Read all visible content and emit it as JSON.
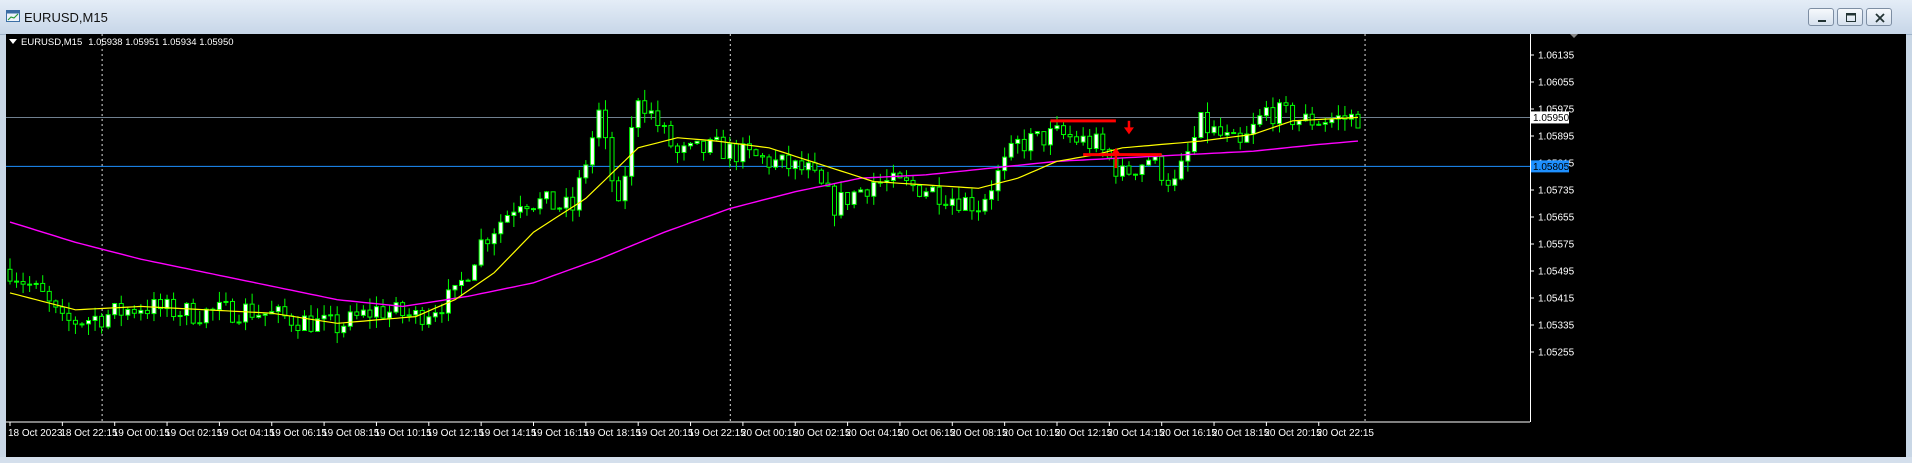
{
  "window": {
    "title": "EURUSD,M15",
    "minimize_icon": "minimize-icon",
    "maximize_icon": "maximize-icon",
    "close_icon": "close-icon"
  },
  "chart_info": {
    "symbol": "EURUSD,M15",
    "quotes": "1.05938 1.05951 1.05934 1.05950"
  },
  "colors": {
    "background": "#000000",
    "foreground": "#ffffff",
    "bull_candle": "#00ff00",
    "bear_candle_body": "#000000",
    "fast_ma": "#ffff00",
    "slow_ma": "#ff00ff",
    "bid_line": "#708090",
    "horizontal_line": "#1e90ff",
    "bid_tag": "#ffffff",
    "hline_tag": "#1e90ff",
    "annotation": "#ff0000"
  },
  "chart_data": {
    "type": "candlestick",
    "yaxis": {
      "ylim": [
        1.0524,
        1.0619
      ],
      "tick_values": [
        1.06135,
        1.06055,
        1.05975,
        1.05895,
        1.05815,
        1.05735,
        1.05655,
        1.05575,
        1.05495,
        1.05415,
        1.05335,
        1.05255
      ],
      "tick_labels": [
        "1.06135",
        "1.06055",
        "1.05975",
        "1.05895",
        "1.05815",
        "1.05735",
        "1.05655",
        "1.05575",
        "1.05495",
        "1.05415",
        "1.05335",
        "1.05255"
      ]
    },
    "xaxis": {
      "tick_labels": [
        "18 Oct 2023",
        "18 Oct 22:15",
        "19 Oct 00:15",
        "19 Oct 02:15",
        "19 Oct 04:15",
        "19 Oct 06:15",
        "19 Oct 08:15",
        "19 Oct 10:15",
        "19 Oct 12:15",
        "19 Oct 14:15",
        "19 Oct 16:15",
        "19 Oct 18:15",
        "19 Oct 20:15",
        "19 Oct 22:15",
        "20 Oct 00:15",
        "20 Oct 02:15",
        "20 Oct 04:15",
        "20 Oct 06:15",
        "20 Oct 08:15",
        "20 Oct 10:15",
        "20 Oct 12:15",
        "20 Oct 14:15",
        "20 Oct 16:15",
        "20 Oct 18:15",
        "20 Oct 20:15",
        "20 Oct 22:15"
      ],
      "tick_bar_index": [
        0,
        8,
        16,
        24,
        32,
        40,
        48,
        56,
        64,
        72,
        80,
        88,
        96,
        104,
        112,
        120,
        128,
        136,
        144,
        152,
        160,
        168,
        176,
        184,
        192,
        200
      ],
      "day_separator_bar_index": [
        14,
        110,
        207
      ]
    },
    "close_path_anchors": [
      [
        0,
        1.055
      ],
      [
        5,
        1.0542
      ],
      [
        8,
        1.0534
      ],
      [
        14,
        1.0536
      ],
      [
        20,
        1.0539
      ],
      [
        28,
        1.0537
      ],
      [
        36,
        1.0538
      ],
      [
        44,
        1.0535
      ],
      [
        50,
        1.0533
      ],
      [
        56,
        1.0538
      ],
      [
        62,
        1.0536
      ],
      [
        68,
        1.0542
      ],
      [
        72,
        1.0558
      ],
      [
        78,
        1.0571
      ],
      [
        86,
        1.0568
      ],
      [
        90,
        1.0596
      ],
      [
        93,
        1.0567
      ],
      [
        96,
        1.0602
      ],
      [
        99,
        1.0593
      ],
      [
        102,
        1.0584
      ],
      [
        108,
        1.0586
      ],
      [
        114,
        1.0583
      ],
      [
        122,
        1.0579
      ],
      [
        126,
        1.0569
      ],
      [
        132,
        1.0576
      ],
      [
        140,
        1.0574
      ],
      [
        148,
        1.0569
      ],
      [
        154,
        1.0587
      ],
      [
        160,
        1.059
      ],
      [
        166,
        1.0587
      ],
      [
        170,
        1.0578
      ],
      [
        174,
        1.0583
      ],
      [
        178,
        1.0575
      ],
      [
        182,
        1.0593
      ],
      [
        188,
        1.0586
      ],
      [
        192,
        1.0597
      ],
      [
        198,
        1.0594
      ],
      [
        206,
        1.0595
      ]
    ],
    "fast_ma_anchors": [
      [
        0,
        1.0543
      ],
      [
        10,
        1.0538
      ],
      [
        20,
        1.0539
      ],
      [
        30,
        1.0538
      ],
      [
        40,
        1.0537
      ],
      [
        50,
        1.0534
      ],
      [
        56,
        1.0535
      ],
      [
        62,
        1.0536
      ],
      [
        68,
        1.0541
      ],
      [
        74,
        1.0549
      ],
      [
        80,
        1.0561
      ],
      [
        88,
        1.0571
      ],
      [
        96,
        1.0586
      ],
      [
        102,
        1.0589
      ],
      [
        108,
        1.0588
      ],
      [
        116,
        1.0586
      ],
      [
        124,
        1.0581
      ],
      [
        132,
        1.0576
      ],
      [
        140,
        1.0575
      ],
      [
        148,
        1.0574
      ],
      [
        154,
        1.0577
      ],
      [
        160,
        1.0582
      ],
      [
        166,
        1.0584
      ],
      [
        170,
        1.0586
      ],
      [
        176,
        1.0587
      ],
      [
        182,
        1.0588
      ],
      [
        190,
        1.059
      ],
      [
        196,
        1.0594
      ],
      [
        206,
        1.0595
      ]
    ],
    "slow_ma_anchors": [
      [
        0,
        1.0564
      ],
      [
        10,
        1.0558
      ],
      [
        20,
        1.0553
      ],
      [
        30,
        1.0549
      ],
      [
        40,
        1.0545
      ],
      [
        50,
        1.0541
      ],
      [
        60,
        1.0539
      ],
      [
        70,
        1.0542
      ],
      [
        80,
        1.0546
      ],
      [
        90,
        1.0553
      ],
      [
        100,
        1.0561
      ],
      [
        110,
        1.0568
      ],
      [
        120,
        1.0573
      ],
      [
        130,
        1.0577
      ],
      [
        140,
        1.0578
      ],
      [
        150,
        1.058
      ],
      [
        160,
        1.0582
      ],
      [
        170,
        1.0583
      ],
      [
        180,
        1.0584
      ],
      [
        190,
        1.0585
      ],
      [
        200,
        1.0587
      ],
      [
        206,
        1.0588
      ]
    ],
    "bar_count": 207,
    "bid_line": {
      "value": 1.0595,
      "label": "1.05950"
    },
    "horizontal_line": {
      "value": 1.05805,
      "label": "1.05805"
    },
    "annotations": [
      {
        "kind": "hline",
        "color": "#ff0000",
        "from_bar": 159,
        "to_bar": 169,
        "value": 1.0594
      },
      {
        "kind": "hline",
        "color": "#ff0000",
        "from_bar": 164,
        "to_bar": 176,
        "value": 1.0584
      },
      {
        "kind": "arrow_down",
        "color": "#ff0000",
        "bar": 171,
        "from": 1.0594,
        "to": 1.059
      },
      {
        "kind": "arrow_up",
        "color": "#ff0000",
        "bar": 169,
        "from": 1.058,
        "to": 1.0586
      }
    ]
  }
}
